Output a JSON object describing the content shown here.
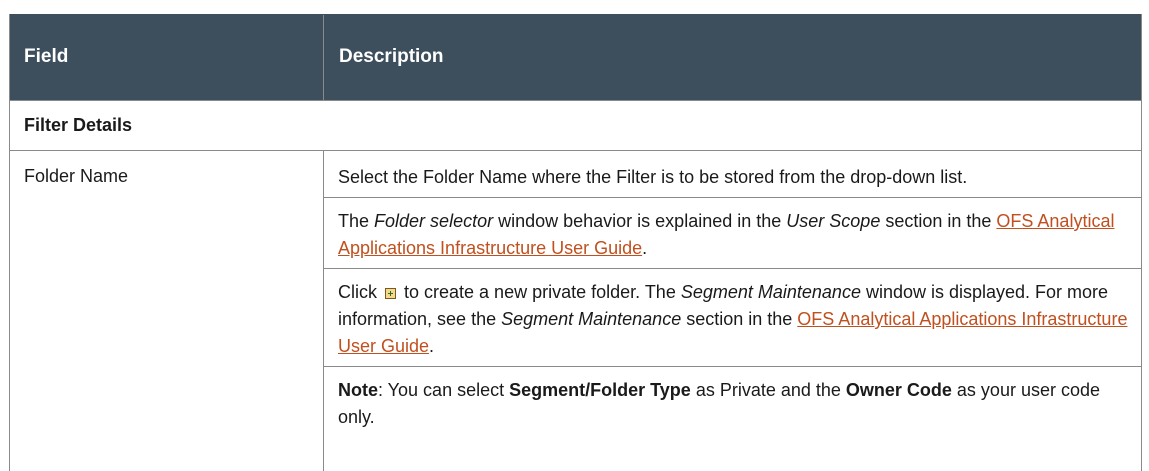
{
  "header": {
    "field": "Field",
    "description": "Description"
  },
  "section": {
    "title": "Filter Details"
  },
  "row": {
    "field": "Folder Name",
    "p1": "Select the Folder Name where the Filter is to be stored from the drop-down list.",
    "p2": {
      "t1": "The ",
      "i1": "Folder selector",
      "t2": " window behavior is explained in the ",
      "i2": "User Scope",
      "t3": " section in the ",
      "link": "OFS Analytical Applications Infrastructure User Guide",
      "t4": "."
    },
    "p3": {
      "t1": "Click ",
      "icon": "add-folder-icon",
      "t2": " to create a new private folder. The ",
      "i1": "Segment Maintenance",
      "t3": " window is displayed. For more information, see the ",
      "i2": "Segment Maintenance",
      "t4": " section in the ",
      "link": "OFS Analytical Applications Infrastructure User Guide",
      "t5": "."
    },
    "p4": {
      "b1": "Note",
      "t1": ": You can select ",
      "b2": "Segment/Folder Type",
      "t2": " as Private and the ",
      "b3": "Owner Code",
      "t3": " as your user code only."
    }
  }
}
